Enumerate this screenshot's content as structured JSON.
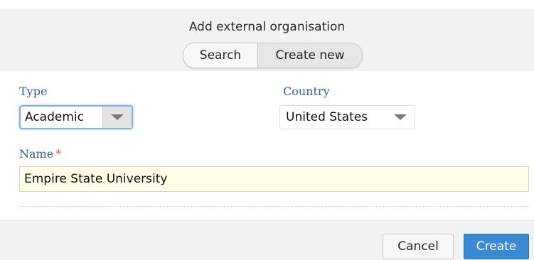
{
  "dialog": {
    "title": "Add external organisation",
    "tabs": [
      {
        "label": "Search",
        "selected": false
      },
      {
        "label": "Create new",
        "selected": true
      }
    ]
  },
  "form": {
    "type": {
      "label": "Type",
      "value": "Academic"
    },
    "country": {
      "label": "Country",
      "value": "United States"
    },
    "name": {
      "label": "Name",
      "required_marker": "*",
      "value": "Empire State University"
    }
  },
  "actions": {
    "cancel_label": "Cancel",
    "create_label": "Create"
  },
  "colors": {
    "label": "#2f5f8f",
    "required": "#e05a5a",
    "primary_button": "#3a8ad3",
    "input_highlight": "#fffde6"
  }
}
